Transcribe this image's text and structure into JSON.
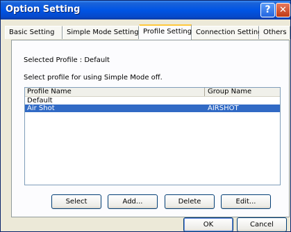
{
  "window": {
    "title": "Option Setting"
  },
  "tabs": [
    {
      "label": "Basic Setting"
    },
    {
      "label": "Simple Mode Setting"
    },
    {
      "label": "Profile Setting"
    },
    {
      "label": "Connection Setting"
    },
    {
      "label": "Others"
    }
  ],
  "active_tab": "Profile Setting",
  "profile": {
    "selected_label": "Selected Profile : Default",
    "instruction": "Select profile for using Simple Mode off.",
    "columns": {
      "name": "Profile Name",
      "group": "Group Name"
    },
    "rows": [
      {
        "name": "Default",
        "group": "",
        "selected": false
      },
      {
        "name": "Air Shot",
        "group": "AIRSHOT",
        "selected": true
      }
    ]
  },
  "buttons": {
    "select": "Select",
    "add": "Add...",
    "delete": "Delete",
    "edit": "Edit...",
    "ok": "OK",
    "cancel": "Cancel"
  },
  "icons": {
    "help": "help-icon",
    "close": "close-icon"
  }
}
